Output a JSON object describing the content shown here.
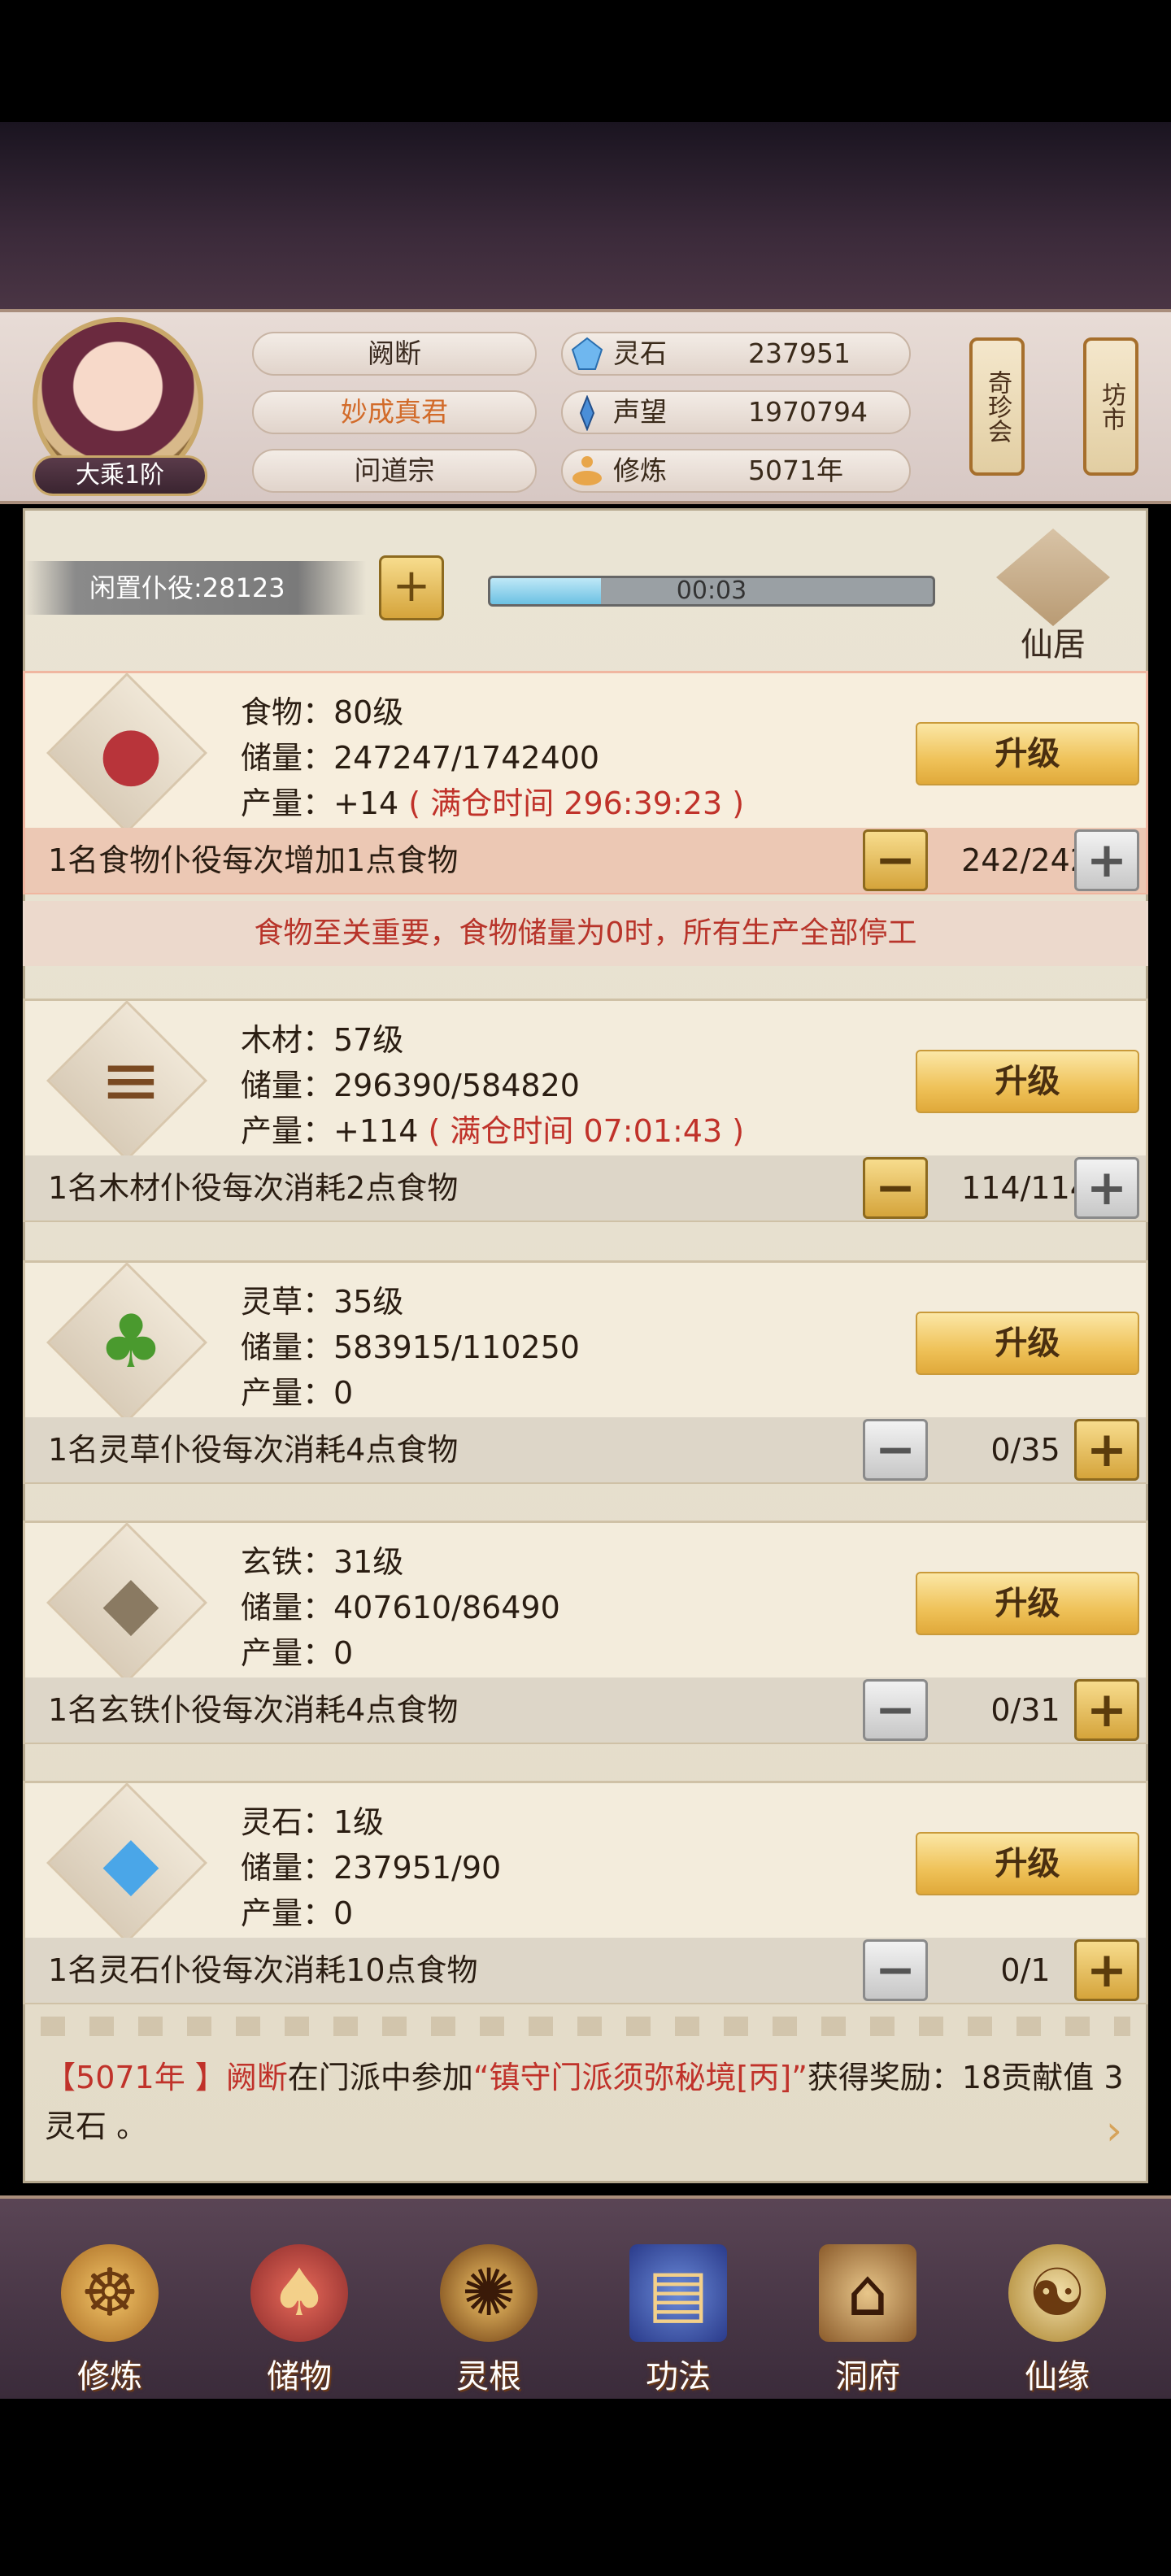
{
  "player": {
    "rank": "大乘1阶",
    "name": "阙断",
    "title": "妙成真君",
    "sect": "问道宗"
  },
  "resources": [
    {
      "label": "灵石",
      "value": "237951",
      "icon": "spirit-stone-icon"
    },
    {
      "label": "声望",
      "value": "1970794",
      "icon": "prestige-icon"
    },
    {
      "label": "修炼",
      "value": "5071年",
      "icon": "cultivation-icon"
    }
  ],
  "side_buttons": [
    {
      "label": "奇珍会"
    },
    {
      "label": "坊市"
    }
  ],
  "idle": {
    "label": "闲置仆役:28123",
    "add": "+",
    "timer": "00:03",
    "timer_progress": 0.25
  },
  "residence": {
    "label": "仙居"
  },
  "items": [
    {
      "name_line": "食物：80级",
      "storage_line": "储量：247247/1742400",
      "output_prefix": "产量：+14",
      "output_full": "( 满仓时间 296:39:23 )",
      "desc": "1名食物仆役每次增加1点食物",
      "count": "242/242",
      "icon": "meat-icon"
    },
    {
      "name_line": "木材：57级",
      "storage_line": "储量：296390/584820",
      "output_prefix": "产量：+114",
      "output_full": "( 满仓时间 07:01:43 )",
      "desc": "1名木材仆役每次消耗2点食物",
      "count": "114/114",
      "icon": "wood-icon"
    },
    {
      "name_line": "灵草：35级",
      "storage_line": "储量：583915/110250",
      "output_prefix": "产量：0",
      "output_full": "",
      "desc": "1名灵草仆役每次消耗4点食物",
      "count": "0/35",
      "icon": "herb-icon"
    },
    {
      "name_line": "玄铁：31级",
      "storage_line": "储量：407610/86490",
      "output_prefix": "产量：0",
      "output_full": "",
      "desc": "1名玄铁仆役每次消耗4点食物",
      "count": "0/31",
      "icon": "iron-ore-icon"
    },
    {
      "name_line": "灵石：1级",
      "storage_line": "储量：237951/90",
      "output_prefix": "产量：0",
      "output_full": "",
      "desc": "1名灵石仆役每次消耗10点食物",
      "count": "0/1",
      "icon": "crystal-icon"
    }
  ],
  "upgrade_label": "升级",
  "minus": "−",
  "plus": "+",
  "food_warning": "食物至关重要，食物储量为0时，所有生产全部停工",
  "log": {
    "open": "【",
    "year": "5071年",
    "close": " 】",
    "actor": "阙断",
    "text1": "在门派中参加",
    "event": "“镇守门派须弥秘境[丙]”",
    "text2": "获得奖励：18贡献值 3灵石 。"
  },
  "nav": [
    {
      "label": "修炼",
      "icon": "meditating-figure-icon"
    },
    {
      "label": "储物",
      "icon": "storage-bag-icon"
    },
    {
      "label": "灵根",
      "icon": "spirit-root-icon"
    },
    {
      "label": "功法",
      "icon": "scripture-book-icon"
    },
    {
      "label": "洞府",
      "icon": "cave-mansion-icon"
    },
    {
      "label": "仙缘",
      "icon": "immortal-fate-icon"
    }
  ]
}
